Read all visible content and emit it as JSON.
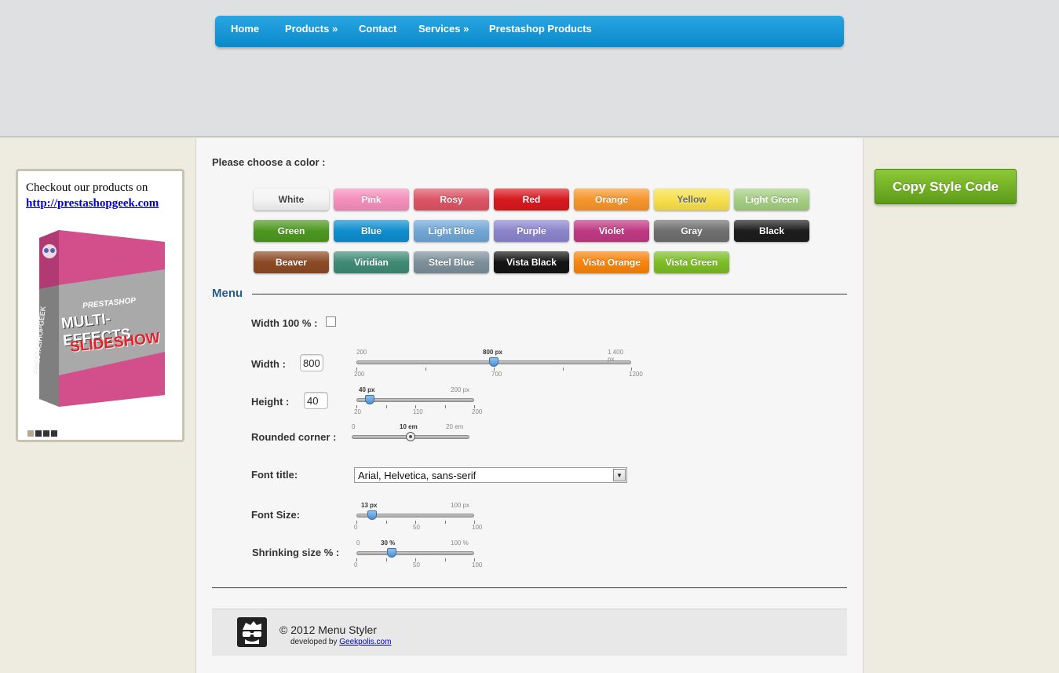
{
  "nav": {
    "items": [
      {
        "label": "Home"
      },
      {
        "label": "Products »"
      },
      {
        "label": "Contact"
      },
      {
        "label": "Services »"
      },
      {
        "label": "Prestashop Products"
      }
    ]
  },
  "colors_section": {
    "prompt": "Please choose a color :",
    "buttons": [
      {
        "label": "White",
        "color": "#f4f4f4"
      },
      {
        "label": "Pink",
        "color": "#f58fbd"
      },
      {
        "label": "Rosy",
        "color": "#dc5565"
      },
      {
        "label": "Red",
        "color": "#d7191f"
      },
      {
        "label": "Orange",
        "color": "#f6962c"
      },
      {
        "label": "Yellow",
        "color": "#f6e04c"
      },
      {
        "label": "Light Green",
        "color": "#a4ce82"
      },
      {
        "label": "Green",
        "color": "#4d9720"
      },
      {
        "label": "Blue",
        "color": "#0f8ecf"
      },
      {
        "label": "Light Blue",
        "color": "#71a6d6"
      },
      {
        "label": "Purple",
        "color": "#8b85cc"
      },
      {
        "label": "Violet",
        "color": "#bf3a84"
      },
      {
        "label": "Gray",
        "color": "#6f6f6f"
      },
      {
        "label": "Black",
        "color": "#1d1d1d"
      },
      {
        "label": "Beaver",
        "color": "#8c4a24"
      },
      {
        "label": "Viridian",
        "color": "#3f8b74"
      },
      {
        "label": "Steel Blue",
        "color": "#7d8f9a"
      },
      {
        "label": "Vista Black",
        "color": "#141414"
      },
      {
        "label": "Vista Orange",
        "color": "#f8840b"
      },
      {
        "label": "Vista Green",
        "color": "#7cbd26"
      }
    ]
  },
  "menu": {
    "title": "Menu",
    "width_full_label": "Width 100 % :",
    "width_full_checked": false,
    "width": {
      "label": "Width :",
      "value": "800",
      "min": "200",
      "max_label": "1 400 px",
      "cur_label": "800 px",
      "scale": [
        "200",
        "700",
        "1200"
      ],
      "fraction": 0.5
    },
    "height": {
      "label": "Height :",
      "value": "40",
      "max_label": "200 px",
      "cur_label": "40 px",
      "scale": [
        "20",
        "110",
        "200"
      ],
      "fraction": 0.111
    },
    "rounded": {
      "label": "Rounded corner :",
      "min": "0",
      "cur_label": "10 em",
      "max_label": "20 em",
      "fraction": 0.5
    },
    "font_title": {
      "label": "Font title:",
      "value": "Arial, Helvetica, sans-serif"
    },
    "font_size": {
      "label": "Font Size:",
      "cur_label": "13 px",
      "max_label": "100 px",
      "scale": [
        "0",
        "50",
        "100"
      ],
      "fraction": 0.13
    },
    "shrink": {
      "label": "Shrinking size % :",
      "min": "0",
      "cur_label": "30 %",
      "max_label": "100 %",
      "scale": [
        "0",
        "50",
        "100"
      ],
      "fraction": 0.3
    }
  },
  "footer": {
    "copyright": "© 2012 Menu Styler",
    "developed_by": "developed by",
    "developer_link": "Geekpolis.com"
  },
  "sidebar": {
    "text": "Checkout our products on",
    "link": "http://prestashopgeek.com",
    "box_brand": "PRESTASHOP",
    "box_title_1": "MULTI-EFFECTS",
    "box_title_2": "SLIDESHOW",
    "box_side": "PRESTASHOPGEEK"
  },
  "copy_button": {
    "label": "Copy Style Code"
  }
}
